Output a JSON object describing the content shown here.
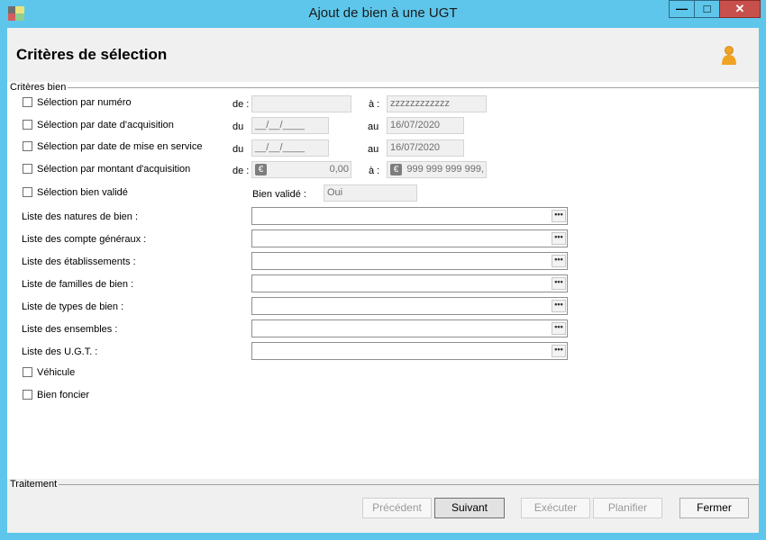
{
  "window": {
    "title": "Ajout de bien à une UGT",
    "minimize_glyph": "—",
    "maximize_glyph": "□",
    "close_glyph": "✕"
  },
  "header": {
    "title": "Critères de sélection",
    "icon": "user-icon"
  },
  "criteria_group": {
    "label": "Critères bien"
  },
  "rows": {
    "numero": {
      "label": "Sélection par numéro",
      "from_label": "de :",
      "from_value": "",
      "to_label": "à :",
      "to_value": "zzzzzzzzzzzz"
    },
    "date_acq": {
      "label": "Sélection par date d'acquisition",
      "from_label": "du",
      "from_value": "__/__/____",
      "to_label": "au",
      "to_value": "16/07/2020"
    },
    "date_service": {
      "label": "Sélection par date de mise en service",
      "from_label": "du",
      "from_value": "__/__/____",
      "to_label": "au",
      "to_value": "16/07/2020"
    },
    "montant": {
      "label": "Sélection par montant d'acquisition",
      "from_label": "de :",
      "from_value": "0,00",
      "to_label": "à :",
      "to_value": "999 999 999 999,",
      "currency_glyph": "€"
    },
    "valide": {
      "label": "Sélection bien validé",
      "field_label": "Bien validé :",
      "value": "Oui"
    }
  },
  "lists": [
    {
      "label": "Liste des natures de bien :"
    },
    {
      "label": "Liste des compte généraux :"
    },
    {
      "label": "Liste des établissements :"
    },
    {
      "label": "Liste de familles de bien :"
    },
    {
      "label": "Liste de types de bien :"
    },
    {
      "label": "Liste des ensembles :"
    },
    {
      "label": "Liste des U.G.T. :"
    }
  ],
  "ellipsis": "•••",
  "checks": {
    "vehicule": "Véhicule",
    "foncier": "Bien foncier"
  },
  "treatment_group": {
    "label": "Traitement"
  },
  "buttons": {
    "precedent": "Précédent",
    "suivant": "Suivant",
    "executer": "Exécuter",
    "planifier": "Planifier",
    "fermer": "Fermer"
  },
  "colors": {
    "titlebar": "#5ec6ea",
    "close": "#c7504c",
    "panel": "#f0f0f0"
  }
}
